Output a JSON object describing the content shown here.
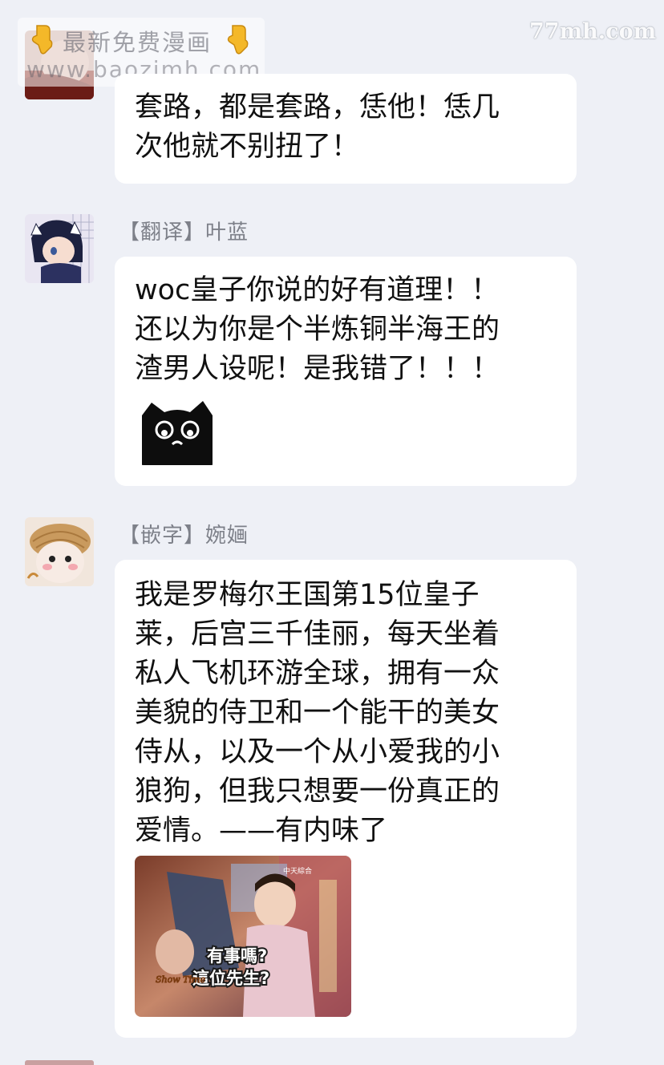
{
  "overlay": {
    "line1": "最新免费漫画",
    "line2": "www.baozimh.com",
    "right_watermark": "77mh.com"
  },
  "messages": [
    {
      "sender": "",
      "text": "套路，都是套路，恁他！恁几\n次他就不别扭了！"
    },
    {
      "sender": "【翻译】叶蓝",
      "text": "woc皇子你说的好有道理！！\n还以为你是个半炼铜半海王的\n渣男人设呢！是我错了！！！",
      "sticker": "black-cat-sticker"
    },
    {
      "sender": "【嵌字】婉婳",
      "text": "我是罗梅尔王国第15位皇子\n莱，后宫三千佳丽，每天坐着\n私人飞机环游全球，拥有一众\n美貌的侍卫和一个能干的美女\n侍从，以及一个从小爱我的小\n狼狗，但我只想要一份真正的\n爱情。——有内味了",
      "image_caption_line1": "有事嗎?",
      "image_caption_line2": "這位先生?",
      "image_logo": "Show Time"
    }
  ],
  "colors": {
    "background": "#eef0f6",
    "bubble": "#ffffff",
    "sender_text": "#7d8089",
    "message_text": "#111111"
  }
}
